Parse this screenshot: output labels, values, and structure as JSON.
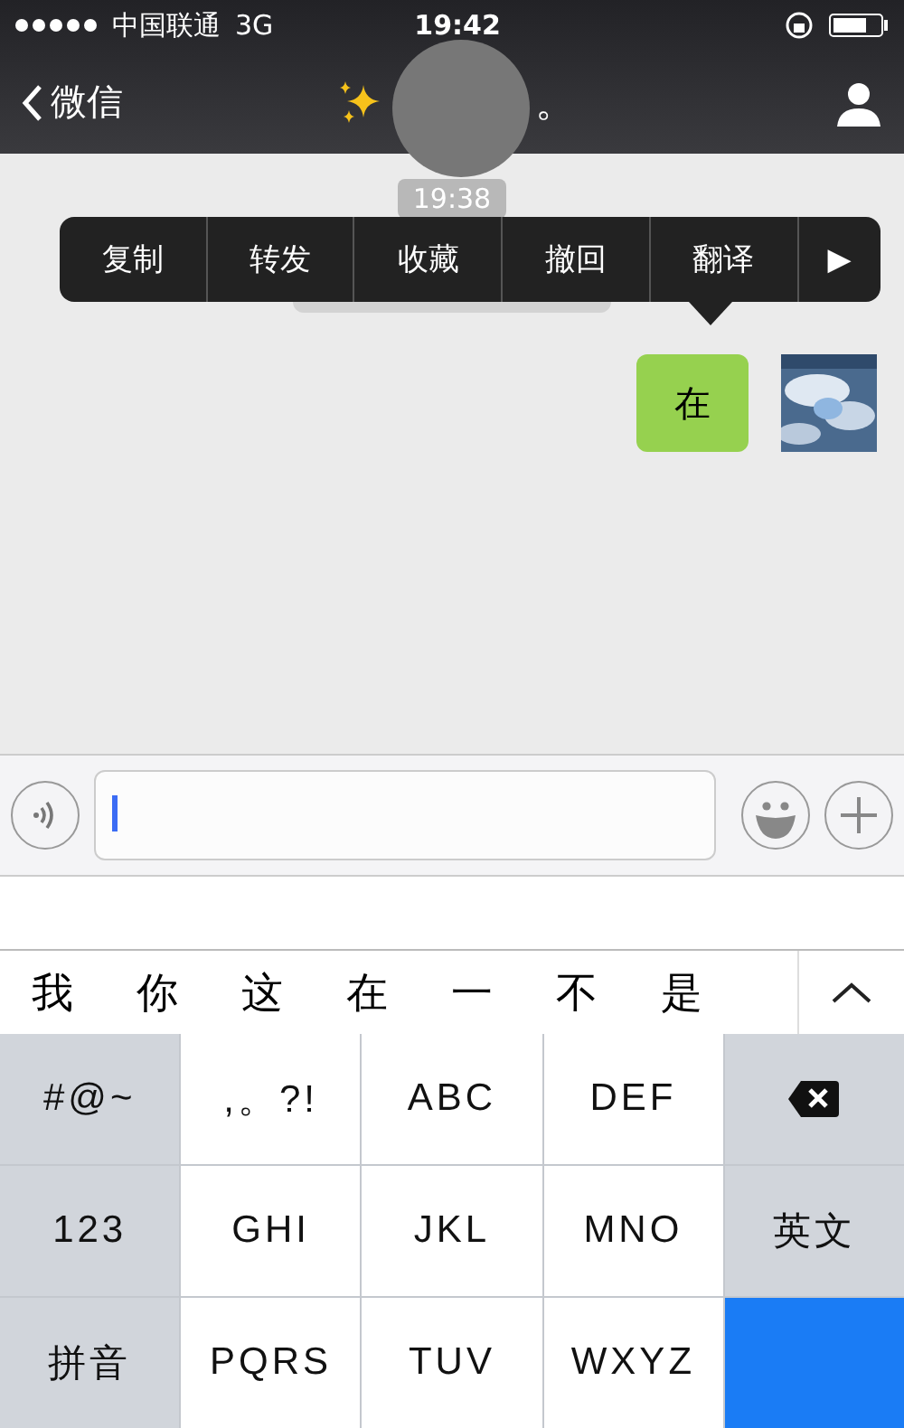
{
  "status_bar": {
    "carrier": "中国联通",
    "network": "3G",
    "time": "19:42"
  },
  "nav": {
    "back": "微信",
    "title_end": "。"
  },
  "chat": {
    "timestamp": "19:38",
    "messages": [
      {
        "text": "在",
        "outgoing": true
      }
    ]
  },
  "context_menu": {
    "items": [
      "复制",
      "转发",
      "收藏",
      "撤回",
      "翻译"
    ],
    "more": "▶"
  },
  "candidates": [
    "我",
    "你",
    "这",
    "在",
    "一",
    "不",
    "是"
  ],
  "keyboard": {
    "rows": [
      [
        {
          "label": "#@~",
          "kind": "function"
        },
        {
          "label": ",。?!",
          "kind": "letter"
        },
        {
          "label": "ABC",
          "kind": "letter"
        },
        {
          "label": "DEF",
          "kind": "letter"
        },
        {
          "kind": "delete"
        }
      ],
      [
        {
          "label": "123",
          "kind": "function"
        },
        {
          "label": "GHI",
          "kind": "letter"
        },
        {
          "label": "JKL",
          "kind": "letter"
        },
        {
          "label": "MNO",
          "kind": "letter"
        },
        {
          "label": "英文",
          "kind": "function"
        }
      ],
      [
        {
          "label": "拼音",
          "kind": "function"
        },
        {
          "label": "PQRS",
          "kind": "letter"
        },
        {
          "label": "TUV",
          "kind": "letter"
        },
        {
          "label": "WXYZ",
          "kind": "letter"
        },
        {
          "kind": "send"
        }
      ]
    ]
  }
}
